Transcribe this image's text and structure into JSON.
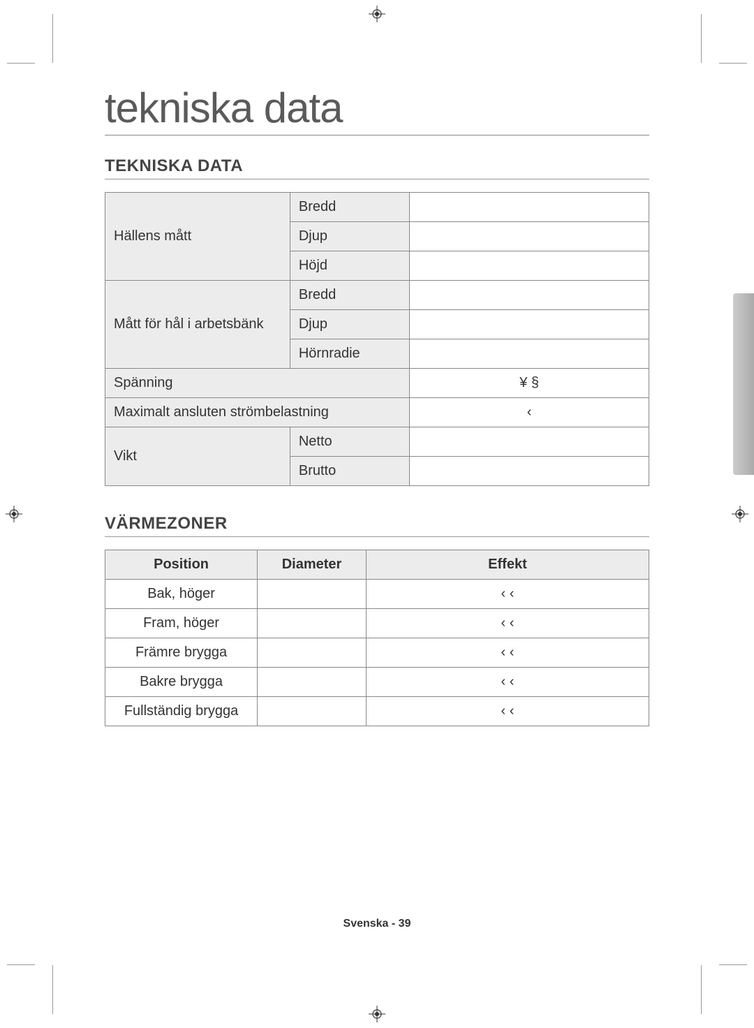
{
  "title": "tekniska data",
  "section1_heading": "TEKNISKA DATA",
  "section2_heading": "VÄRMEZONER",
  "spec_table": {
    "hallens_matt": "Hällens mått",
    "bredd": "Bredd",
    "djup": "Djup",
    "hojd": "Höjd",
    "matt_for_hal": "Mått för hål i arbetsbänk",
    "hornradie": "Hörnradie",
    "spanning": "Spänning",
    "spanning_val": "¥   §",
    "max_load": "Maximalt ansluten strömbelastning",
    "max_load_val": "‹",
    "vikt": "Vikt",
    "netto": "Netto",
    "brutto": "Brutto"
  },
  "zones_headers": {
    "position": "Position",
    "diameter": "Diameter",
    "effekt": "Effekt"
  },
  "zones": [
    {
      "position": "Bak, höger",
      "diameter": "",
      "effekt": "‹          ‹"
    },
    {
      "position": "Fram, höger",
      "diameter": "",
      "effekt": "‹          ‹"
    },
    {
      "position": "Främre brygga",
      "diameter": "",
      "effekt": "‹          ‹"
    },
    {
      "position": "Bakre brygga",
      "diameter": "",
      "effekt": "‹          ‹"
    },
    {
      "position": "Fullständig brygga",
      "diameter": "",
      "effekt": "‹          ‹"
    }
  ],
  "footer": "Svenska - 39"
}
